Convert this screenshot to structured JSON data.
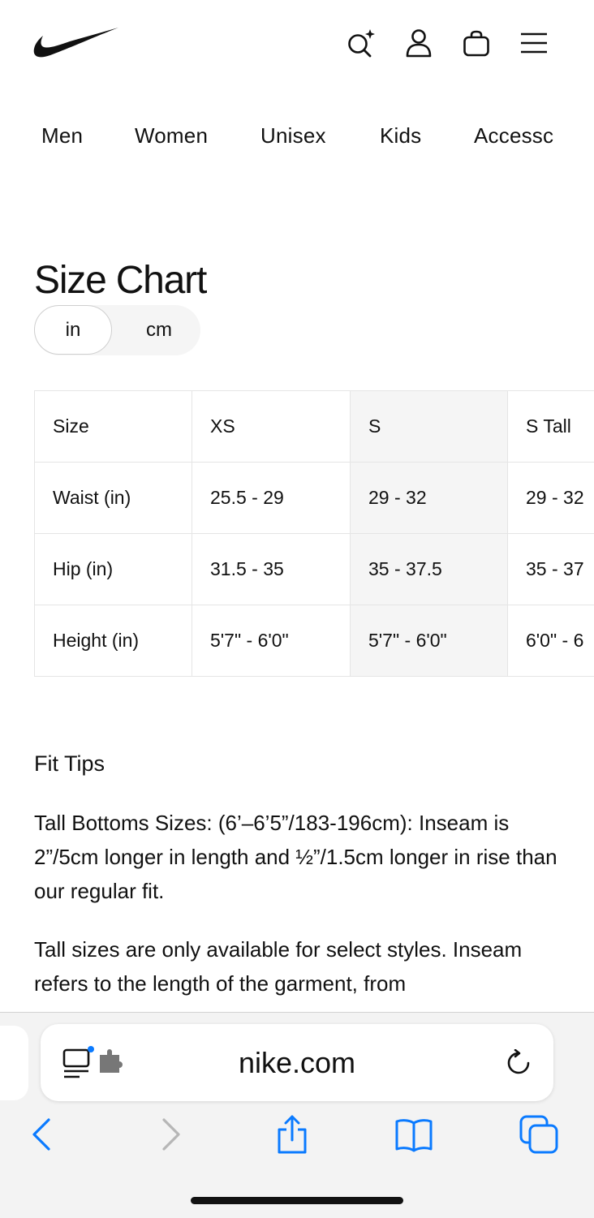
{
  "header": {
    "logo": "nike-swoosh-logo",
    "icons": [
      "search-sparkle-icon",
      "user-icon",
      "bag-icon",
      "menu-icon"
    ]
  },
  "nav": {
    "items": [
      "Men",
      "Women",
      "Unisex",
      "Kids",
      "Accessc"
    ]
  },
  "size_chart": {
    "title": "Size Chart",
    "units": {
      "active": "in",
      "inactive": "cm"
    },
    "table": {
      "rows": [
        [
          "Size",
          "XS",
          "S",
          "S Tall"
        ],
        [
          "Waist (in)",
          "25.5 - 29",
          "29 - 32",
          "29 - 32"
        ],
        [
          "Hip (in)",
          "31.5 - 35",
          "35 - 37.5",
          "35 - 37"
        ],
        [
          "Height (in)",
          "5'7\" - 6'0\"",
          "5'7\" - 6'0\"",
          "6'0\" - 6"
        ]
      ]
    }
  },
  "fit_tips": {
    "title": "Fit Tips",
    "paragraphs": [
      "Tall Bottoms Sizes: (6’–6’5”/183-196cm): Inseam is 2”/5cm longer in length and ½”/1.5cm longer in rise than our regular fit.",
      "Tall sizes are only available for select styles. Inseam refers to the length of the garment, from"
    ]
  },
  "browser": {
    "url": "nike.com",
    "accent": "#0a7aff",
    "toolbar_icons": [
      "back-icon",
      "forward-icon",
      "share-icon",
      "bookmarks-icon",
      "tabs-icon"
    ]
  }
}
